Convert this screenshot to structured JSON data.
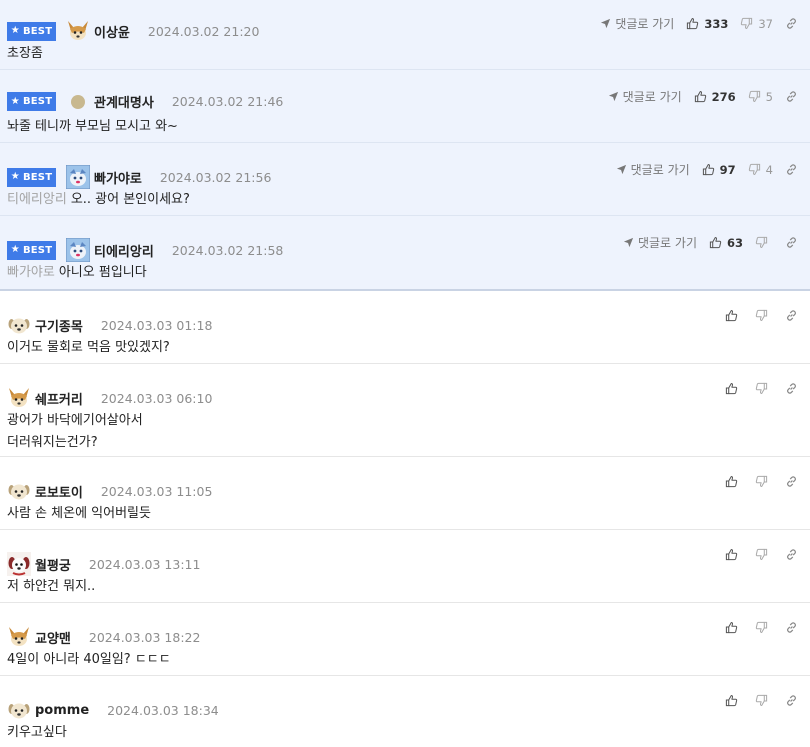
{
  "best_label": "BEST",
  "reply_label": "댓글로 가기",
  "comments": [
    {
      "best": true,
      "avatar": "fox",
      "nick": "이상윤",
      "date": "2024.03.02 21:20",
      "up": "333",
      "down": "37",
      "lines": [
        "초장좀"
      ]
    },
    {
      "best": true,
      "avatar": "dot",
      "nick": "관계대명사",
      "date": "2024.03.02 21:46",
      "up": "276",
      "down": "5",
      "lines": [
        "놔줄 테니까 부모님 모시고 와~"
      ]
    },
    {
      "best": true,
      "avatar": "blue",
      "nick": "빠가야로",
      "date": "2024.03.02 21:56",
      "up": "97",
      "down": "4",
      "mention": "티에리앙리",
      "lines": [
        "오.. 광어 본인이세요?"
      ]
    },
    {
      "best": true,
      "avatar": "blue",
      "nick": "티에리앙리",
      "date": "2024.03.02 21:58",
      "up": "63",
      "down": "",
      "mention": "빠가야로",
      "lines": [
        "아니오 펌입니다"
      ]
    },
    {
      "best": false,
      "avatar": "puppy",
      "nick": "구기종목",
      "date": "2024.03.03 01:18",
      "up": "",
      "down": "",
      "lines": [
        "이거도 물회로 먹음 맛있겠지?"
      ]
    },
    {
      "best": false,
      "avatar": "fox",
      "nick": "쉐프커리",
      "date": "2024.03.03 06:10",
      "up": "",
      "down": "",
      "lines": [
        "광어가 바닥에기어살아서",
        "더러워지는건가?"
      ]
    },
    {
      "best": false,
      "avatar": "puppy",
      "nick": "로보토이",
      "date": "2024.03.03 11:05",
      "up": "",
      "down": "",
      "lines": [
        "사람 손 체온에 익어버릴듯"
      ]
    },
    {
      "best": false,
      "avatar": "red",
      "nick": "월평궁",
      "date": "2024.03.03 13:11",
      "up": "",
      "down": "",
      "lines": [
        "저 하얀건 뭐지.."
      ]
    },
    {
      "best": false,
      "avatar": "fox",
      "nick": "교양맨",
      "date": "2024.03.03 18:22",
      "up": "",
      "down": "",
      "lines": [
        "4일이 아니라 40일임? ㄷㄷㄷ"
      ]
    },
    {
      "best": false,
      "avatar": "puppy",
      "nick": "pomme",
      "date": "2024.03.03 18:34",
      "up": "",
      "down": "",
      "lines": [
        "키우고싶다"
      ]
    }
  ]
}
